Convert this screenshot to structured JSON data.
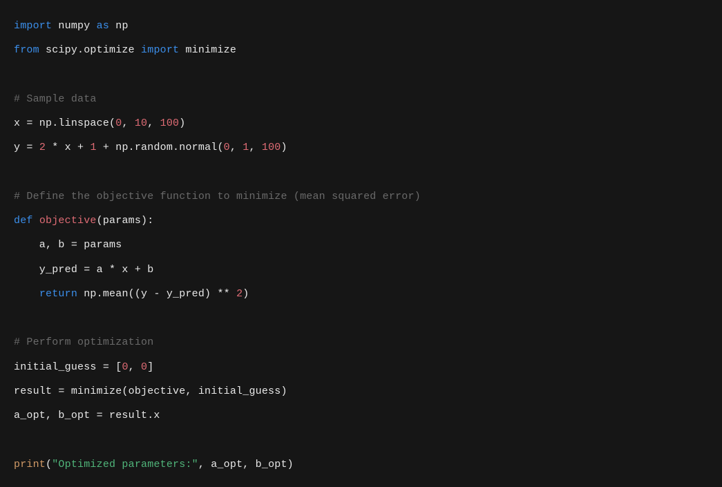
{
  "code": {
    "l1": {
      "t1": "import",
      "t2": " numpy ",
      "t3": "as",
      "t4": " np"
    },
    "l2": {
      "t1": "from",
      "t2": " scipy.optimize ",
      "t3": "import",
      "t4": " minimize"
    },
    "l3": "",
    "l4": {
      "t1": "# Sample data"
    },
    "l5": {
      "t1": "x = np.linspace(",
      "t2": "0",
      "t3": ", ",
      "t4": "10",
      "t5": ", ",
      "t6": "100",
      "t7": ")"
    },
    "l6": {
      "t1": "y = ",
      "t2": "2",
      "t3": " * x + ",
      "t4": "1",
      "t5": " + np.random.normal(",
      "t6": "0",
      "t7": ", ",
      "t8": "1",
      "t9": ", ",
      "t10": "100",
      "t11": ")"
    },
    "l7": "",
    "l8": {
      "t1": "# Define the objective function to minimize (mean squared error)"
    },
    "l9": {
      "t1": "def",
      "t2": " ",
      "t3": "objective",
      "t4": "(params):"
    },
    "l10": {
      "t1": "    a, b = params"
    },
    "l11": {
      "t1": "    y_pred = a * x + b"
    },
    "l12": {
      "t1": "    ",
      "t2": "return",
      "t3": " np.mean((y - y_pred) ** ",
      "t4": "2",
      "t5": ")"
    },
    "l13": "",
    "l14": {
      "t1": "# Perform optimization"
    },
    "l15": {
      "t1": "initial_guess = [",
      "t2": "0",
      "t3": ", ",
      "t4": "0",
      "t5": "]"
    },
    "l16": {
      "t1": "result = minimize(objective, initial_guess)"
    },
    "l17": {
      "t1": "a_opt, b_opt = result.x"
    },
    "l18": "",
    "l19": {
      "t1": "print",
      "t2": "(",
      "t3": "\"Optimized parameters:\"",
      "t4": ", a_opt, b_opt)"
    }
  }
}
